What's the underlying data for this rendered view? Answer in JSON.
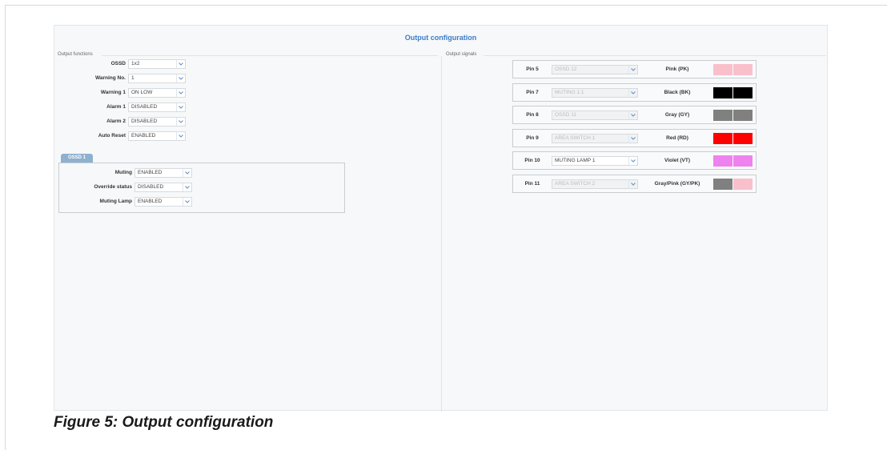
{
  "title": "Output configuration",
  "output_functions": {
    "section_label": "Output functions",
    "rows": [
      {
        "label": "OSSD",
        "value": "1x2"
      },
      {
        "label": "Warning No.",
        "value": "1"
      },
      {
        "label": "Warning 1",
        "value": "ON LOW"
      },
      {
        "label": "Alarm 1",
        "value": "DISABLED"
      },
      {
        "label": "Alarm 2",
        "value": "DISABLED"
      },
      {
        "label": "Auto Reset",
        "value": "ENABLED"
      }
    ]
  },
  "ossd_tab": {
    "label": "OSSD 1",
    "rows": [
      {
        "label": "Muting",
        "value": "ENABLED"
      },
      {
        "label": "Override status",
        "value": "DISABLED"
      },
      {
        "label": "Muting Lamp",
        "value": "ENABLED"
      }
    ]
  },
  "output_signals": {
    "section_label": "Output signals",
    "pins": [
      {
        "pin": "Pin 5",
        "signal": "OSSD 12",
        "disabled": true,
        "color_name": "Pink (PK)",
        "colors": [
          "#f9c0cb",
          "#f9c0cb"
        ]
      },
      {
        "pin": "Pin 7",
        "signal": "MUTING 1.1",
        "disabled": true,
        "color_name": "Black (BK)",
        "colors": [
          "#000000",
          "#000000"
        ]
      },
      {
        "pin": "Pin 8",
        "signal": "OSSD 11",
        "disabled": true,
        "color_name": "Gray (GY)",
        "colors": [
          "#808080",
          "#808080"
        ]
      },
      {
        "pin": "Pin 9",
        "signal": "AREA SWITCH 1",
        "disabled": true,
        "color_name": "Red (RD)",
        "colors": [
          "#ff0000",
          "#ff0000"
        ]
      },
      {
        "pin": "Pin 10",
        "signal": "MUTING LAMP 1",
        "disabled": false,
        "color_name": "Violet (VT)",
        "colors": [
          "#ee82ee",
          "#ee82ee"
        ]
      },
      {
        "pin": "Pin 11",
        "signal": "AREA SWITCH 2",
        "disabled": true,
        "color_name": "Gray/Pink (GY/PK)",
        "colors": [
          "#808080",
          "#f9c0cb"
        ]
      }
    ]
  },
  "caption": "Figure 5: Output configuration"
}
